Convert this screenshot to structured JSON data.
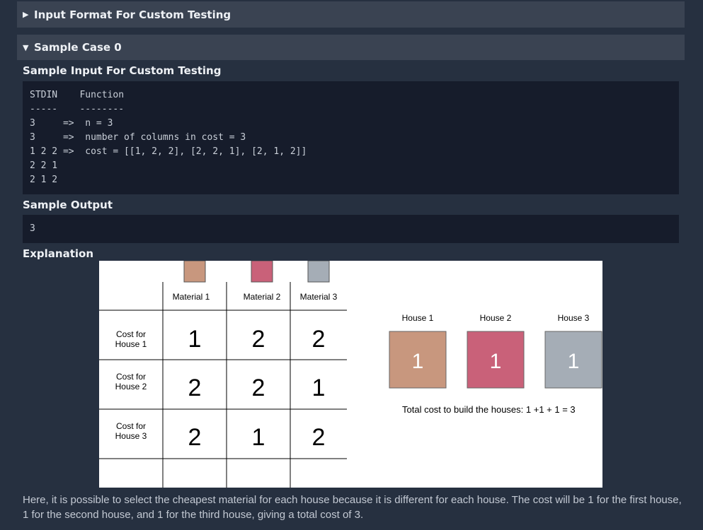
{
  "accordions": {
    "input_format": {
      "label": "Input Format For Custom Testing",
      "icon": "triangle-right-icon"
    },
    "sample_case": {
      "label": "Sample Case 0",
      "icon": "triangle-down-icon"
    }
  },
  "sample_input": {
    "heading": "Sample Input For Custom Testing",
    "lines": [
      "STDIN    Function",
      "-----    --------",
      "3     =>  n = 3",
      "3     =>  number of columns in cost = 3",
      "1 2 2 =>  cost = [[1, 2, 2], [2, 2, 1], [2, 1, 2]]",
      "2 2 1",
      "2 1 2"
    ]
  },
  "sample_output": {
    "heading": "Sample Output",
    "value": "3"
  },
  "explanation": {
    "heading": "Explanation",
    "text": "Here, it is possible to select the cheapest material for each house because it is different for each house. The cost will be 1 for the first house, 1 for the second house, and 1 for the third house, giving a total cost of 3."
  },
  "diagram": {
    "materials": [
      {
        "label": "Material 1",
        "color": "#c8977e"
      },
      {
        "label": "Material 2",
        "color": "#c96179"
      },
      {
        "label": "Material 3",
        "color": "#a5adb6"
      }
    ],
    "rows": [
      {
        "label": [
          "Cost for",
          "House 1"
        ],
        "costs": [
          "1",
          "2",
          "2"
        ]
      },
      {
        "label": [
          "Cost for",
          "House 2"
        ],
        "costs": [
          "2",
          "2",
          "1"
        ]
      },
      {
        "label": [
          "Cost for",
          "House 3"
        ],
        "costs": [
          "2",
          "1",
          "2"
        ]
      }
    ],
    "houses": [
      {
        "label": "House 1",
        "value": "1",
        "color": "#c8977e"
      },
      {
        "label": "House 2",
        "value": "1",
        "color": "#c96179"
      },
      {
        "label": "House 3",
        "value": "1",
        "color": "#a5adb6"
      }
    ],
    "total": "Total cost to build the houses: 1 +1 + 1 = 3"
  }
}
